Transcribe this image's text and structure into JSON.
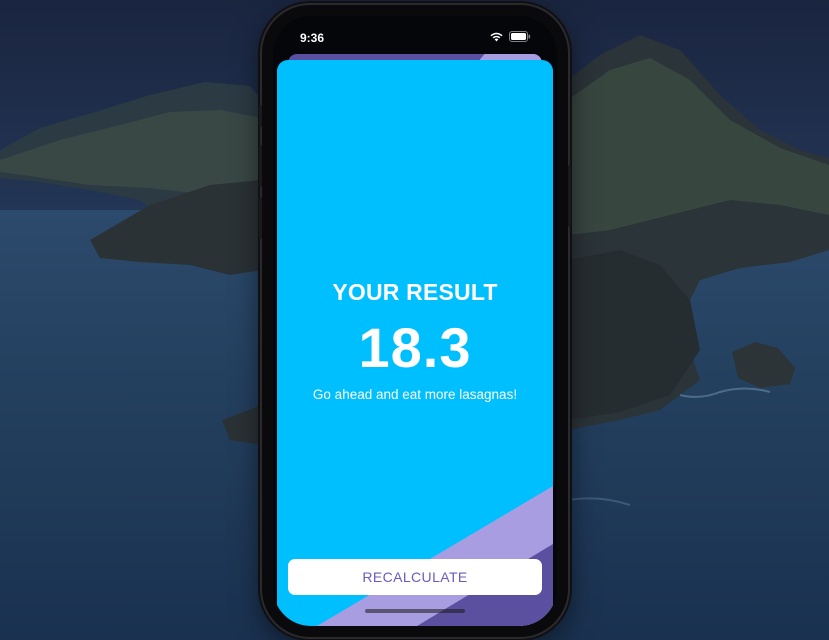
{
  "status_bar": {
    "time": "9:36",
    "icons": [
      "wifi-icon",
      "battery-icon"
    ]
  },
  "result": {
    "title": "YOUR RESULT",
    "value": "18.3",
    "advice": "Go ahead and eat more lasagnas!"
  },
  "actions": {
    "recalculate_label": "RECALCULATE"
  },
  "colors": {
    "background": "#00bfff",
    "accent_purple": "#a99de2",
    "dark_purple": "#5b4fa0",
    "button_text": "#6a5bc2",
    "text": "#ffffff"
  }
}
